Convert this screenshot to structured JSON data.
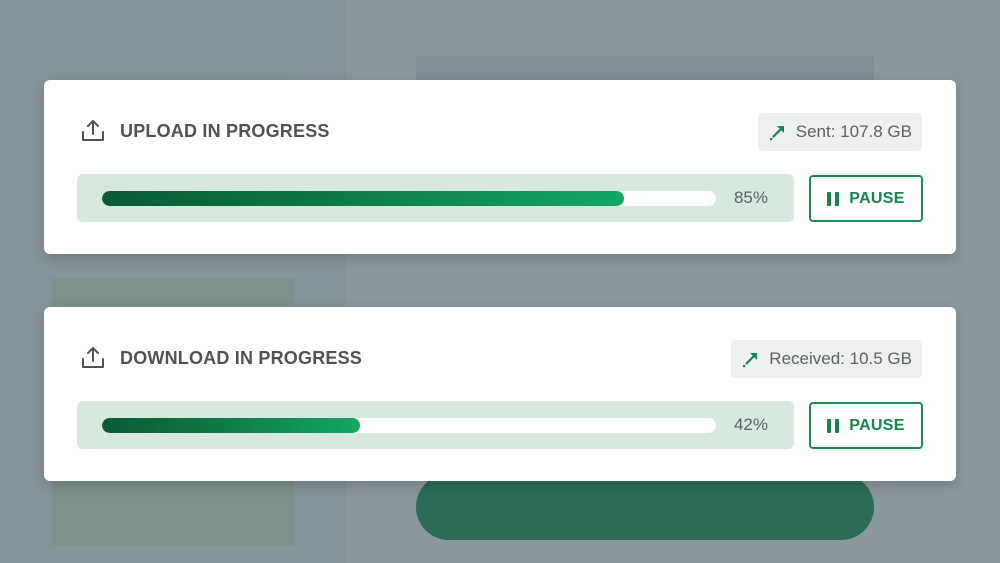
{
  "colors": {
    "accent": "#14864c",
    "progress_start": "#0a5a34",
    "progress_end": "#11a862",
    "track": "#d7e8de"
  },
  "transfers": [
    {
      "title": "UPLOAD IN PROGRESS",
      "icon": "upload-icon",
      "stat_icon": "transfer-arrow-icon",
      "stat_text": "Sent: 107.8 GB",
      "progress": 85,
      "progress_label": "85%",
      "button_icon": "pause-icon",
      "button_label": "PAUSE"
    },
    {
      "title": "DOWNLOAD IN PROGRESS",
      "icon": "upload-icon",
      "stat_icon": "transfer-arrow-icon",
      "stat_text": "Received: 10.5 GB",
      "progress": 42,
      "progress_label": "42%",
      "button_icon": "pause-icon",
      "button_label": "PAUSE"
    }
  ]
}
